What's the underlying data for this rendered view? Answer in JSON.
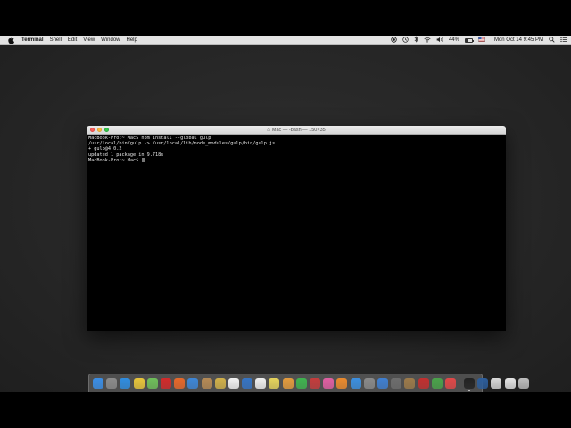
{
  "menubar": {
    "app_name": "Terminal",
    "menus": [
      "Shell",
      "Edit",
      "View",
      "Window",
      "Help"
    ],
    "battery_percent": "44%",
    "battery_level": 0.44,
    "datetime": "Mon Oct 14  9:45 PM"
  },
  "window": {
    "title": "Mac — -bash — 150×35",
    "lines": [
      "MacBook-Pro:~ Mac$ npm install --global gulp",
      "/usr/local/bin/gulp -> /usr/local/lib/node_modules/gulp/bin/gulp.js",
      "+ gulp@4.0.2",
      "updated 1 package in 9.718s",
      "MacBook-Pro:~ Mac$ "
    ]
  },
  "dock": {
    "icons": [
      {
        "name": "finder-icon",
        "color": "#3a8ee6"
      },
      {
        "name": "launchpad-icon",
        "color": "#8c8c8c"
      },
      {
        "name": "safari-icon",
        "color": "#2f8de0"
      },
      {
        "name": "chrome-icon",
        "color": "#e8c53a"
      },
      {
        "name": "maps-icon",
        "color": "#6fbf5a"
      },
      {
        "name": "opera-icon",
        "color": "#d12a2a"
      },
      {
        "name": "firefox-icon",
        "color": "#e6682a"
      },
      {
        "name": "mail-icon",
        "color": "#3d86d6"
      },
      {
        "name": "contacts-icon",
        "color": "#b58a55"
      },
      {
        "name": "notes-icon",
        "color": "#d1b14a"
      },
      {
        "name": "calendar-icon",
        "color": "#f2f2f2"
      },
      {
        "name": "no-sign-icon",
        "color": "#3574c4"
      },
      {
        "name": "reminders-icon",
        "color": "#f0f0f0"
      },
      {
        "name": "stickies-icon",
        "color": "#e5d35c"
      },
      {
        "name": "photos-icon",
        "color": "#e39b3d"
      },
      {
        "name": "facetime-icon",
        "color": "#3fb34f"
      },
      {
        "name": "photo-booth-icon",
        "color": "#c43c3c"
      },
      {
        "name": "itunes-icon",
        "color": "#e05fa3"
      },
      {
        "name": "ibooks-icon",
        "color": "#ea8a2d"
      },
      {
        "name": "app-store-icon",
        "color": "#3b8fe0"
      },
      {
        "name": "system-preferences-icon",
        "color": "#8a8a8a"
      },
      {
        "name": "xcode-icon",
        "color": "#3f7fd0"
      },
      {
        "name": "preview-icon",
        "color": "#6d6d6d"
      },
      {
        "name": "image-capture-icon",
        "color": "#9c7a4a"
      },
      {
        "name": "flag-icon",
        "color": "#c22f2f"
      },
      {
        "name": "android-studio-icon",
        "color": "#4aa24a"
      },
      {
        "name": "red-app-icon",
        "color": "#e04848"
      }
    ],
    "right_icons": [
      {
        "name": "terminal-icon",
        "color": "#222222",
        "running": true
      },
      {
        "name": "quicktime-icon",
        "color": "#2c5d9a"
      },
      {
        "name": "downloads-folder-icon",
        "color": "#d8d8d8"
      },
      {
        "name": "documents-folder-icon",
        "color": "#e4e4e4"
      },
      {
        "name": "trash-icon",
        "color": "#bdbdbd"
      }
    ]
  }
}
